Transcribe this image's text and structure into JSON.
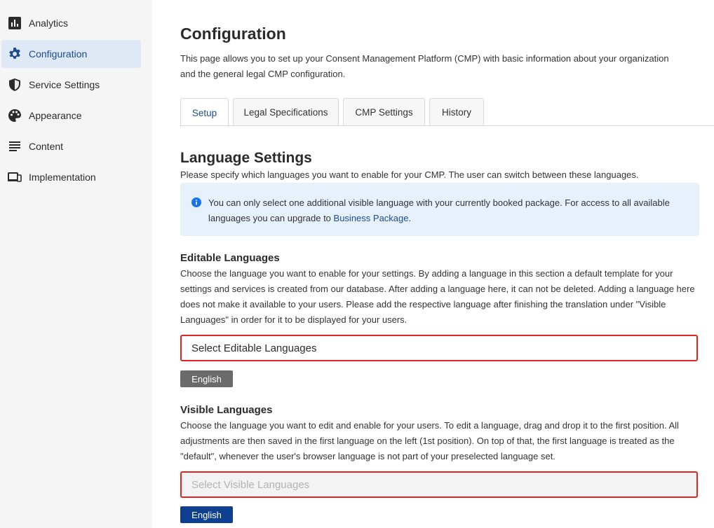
{
  "sidebar": {
    "items": [
      {
        "label": "Analytics",
        "icon": "bar-chart-icon"
      },
      {
        "label": "Configuration",
        "icon": "gear-icon",
        "active": true
      },
      {
        "label": "Service Settings",
        "icon": "shield-icon"
      },
      {
        "label": "Appearance",
        "icon": "palette-icon"
      },
      {
        "label": "Content",
        "icon": "text-lines-icon"
      },
      {
        "label": "Implementation",
        "icon": "devices-icon"
      }
    ]
  },
  "page": {
    "title": "Configuration",
    "description": "This page allows you to set up your Consent Management Platform (CMP) with basic information about your organization and the general legal CMP configuration."
  },
  "tabs": [
    {
      "label": "Setup",
      "active": true
    },
    {
      "label": "Legal Specifications"
    },
    {
      "label": "CMP Settings"
    },
    {
      "label": "History"
    }
  ],
  "language_settings": {
    "title": "Language Settings",
    "description": "Please specify which languages you want to enable for your CMP. The user can switch between these languages.",
    "info": {
      "text": "You can only select one additional visible language with your currently booked package. For access to all available languages you can upgrade to ",
      "link": "Business Package",
      "suffix": "."
    }
  },
  "editable_languages": {
    "title": "Editable Languages",
    "description": "Choose the language you want to enable for your settings. By adding a language in this section a default template for your settings and services is created from our database. After adding a language here, it can not be deleted. Adding a language here does not make it available to your users. Please add the respective language after finishing the translation under \"Visible Languages\" in order for it to be displayed for your users.",
    "placeholder": "Select Editable Languages",
    "chips": [
      "English"
    ]
  },
  "visible_languages": {
    "title": "Visible Languages",
    "description": "Choose the language you want to edit and enable for your users. To edit a language, drag and drop it to the first position. All adjustments are then saved in the first language on the left (1st position). On top of that, the first language is treated as the \"default\", whenever the user's browser language is not part of your preselected language set.",
    "placeholder": "Select Visible Languages",
    "chips": [
      "English"
    ]
  },
  "colors": {
    "accent": "#1c4c8f",
    "error_border": "#e02424",
    "info_bg": "#e6f1fb",
    "chip_active": "#0e3f91",
    "chip_inactive": "#6b6b6b"
  }
}
